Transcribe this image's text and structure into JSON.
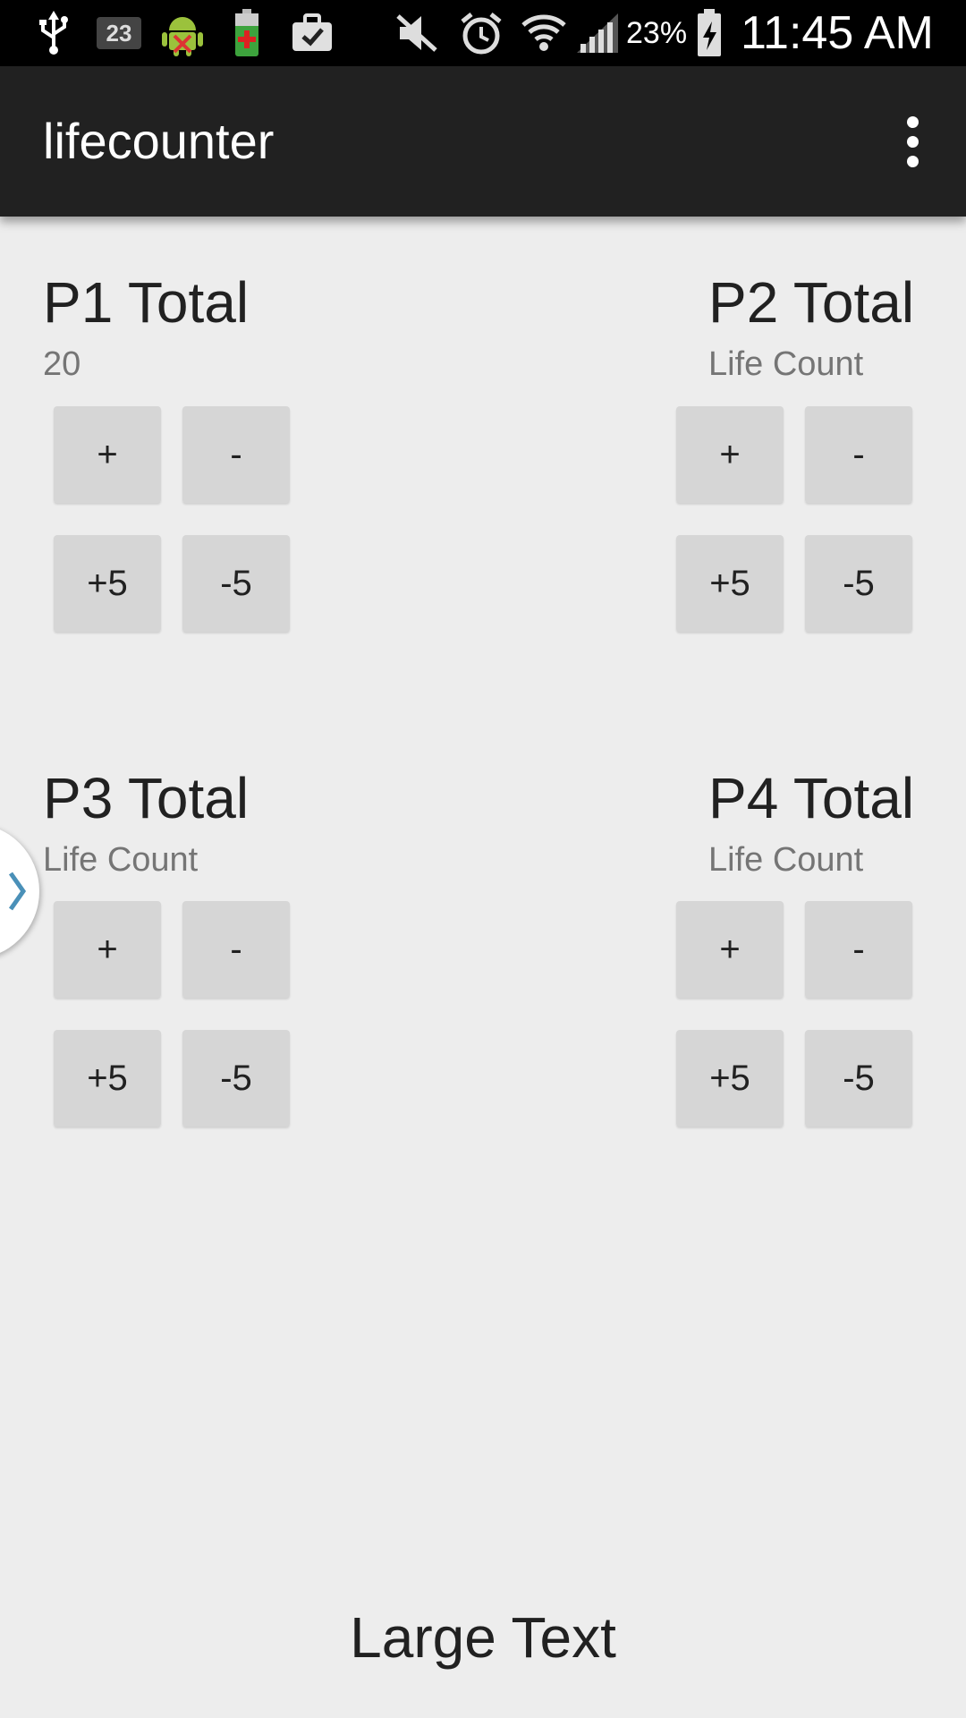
{
  "status_bar": {
    "notification_badge": "23",
    "battery_percent": "23%",
    "time": "11:45 AM",
    "icons": [
      "usb-icon",
      "calendar-badge-icon",
      "android-debug-icon",
      "battery-charging-icon",
      "clipboard-check-icon",
      "mute-icon",
      "alarm-icon",
      "wifi-icon",
      "signal-icon",
      "battery-icon"
    ]
  },
  "app_bar": {
    "title": "lifecounter",
    "overflow_icon": "overflow-menu-icon"
  },
  "players": [
    {
      "title": "P1 Total",
      "count": "20",
      "buttons": {
        "plus": "+",
        "minus": "-",
        "plus5": "+5",
        "minus5": "-5"
      }
    },
    {
      "title": "P2 Total",
      "count": "Life Count",
      "buttons": {
        "plus": "+",
        "minus": "-",
        "plus5": "+5",
        "minus5": "-5"
      }
    },
    {
      "title": "P3 Total",
      "count": "Life Count",
      "buttons": {
        "plus": "+",
        "minus": "-",
        "plus5": "+5",
        "minus5": "-5"
      }
    },
    {
      "title": "P4 Total",
      "count": "Life Count",
      "buttons": {
        "plus": "+",
        "minus": "-",
        "plus5": "+5",
        "minus5": "-5"
      }
    }
  ],
  "drawer_handle_icon": "chevron-right-icon",
  "footer": {
    "large_text": "Large Text"
  },
  "colors": {
    "status_bar": "#000000",
    "app_bar": "#212121",
    "background": "#ededed",
    "button": "#d6d6d6",
    "drawer_chevron": "#4a90b8"
  }
}
